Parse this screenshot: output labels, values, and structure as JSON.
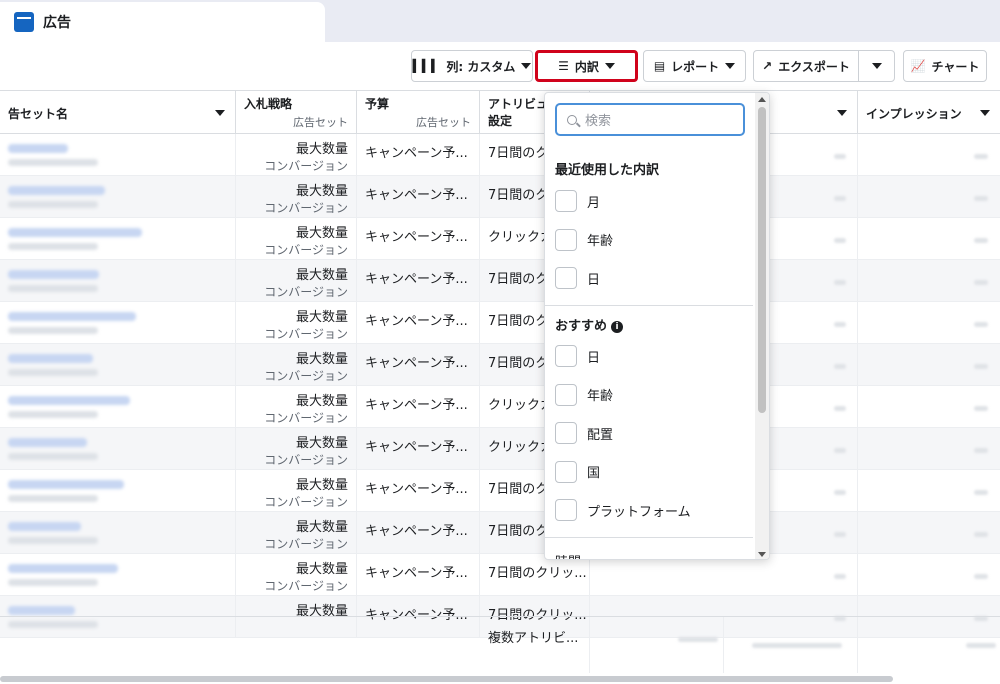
{
  "tab": {
    "label": "広告"
  },
  "toolbar": {
    "columns_label": "列: カスタム",
    "breakdown_label": "内訳",
    "report_label": "レポート",
    "export_label": "エクスポート",
    "chart_label": "チャート"
  },
  "table": {
    "headers": {
      "adset_name": "告セット名",
      "bid_strategy": "入札戦略",
      "bid_strategy_sub": "広告セット",
      "budget": "予算",
      "budget_sub": "広告セット",
      "attribution_line1": "アトリビュー",
      "attribution_line2": "設定",
      "impressions": "インプレッション"
    },
    "rows": [
      {
        "bid": "最大数量",
        "bid_sub": "コンバージョン",
        "budget": "キャンペーン予...",
        "attribution": "7日間のク"
      },
      {
        "bid": "最大数量",
        "bid_sub": "コンバージョン",
        "budget": "キャンペーン予...",
        "attribution": "7日間のク"
      },
      {
        "bid": "最大数量",
        "bid_sub": "コンバージョン",
        "budget": "キャンペーン予...",
        "attribution": "クリックカ"
      },
      {
        "bid": "最大数量",
        "bid_sub": "コンバージョン",
        "budget": "キャンペーン予...",
        "attribution": "7日間のク"
      },
      {
        "bid": "最大数量",
        "bid_sub": "コンバージョン",
        "budget": "キャンペーン予...",
        "attribution": "7日間のク"
      },
      {
        "bid": "最大数量",
        "bid_sub": "コンバージョン",
        "budget": "キャンペーン予...",
        "attribution": "7日間のク"
      },
      {
        "bid": "最大数量",
        "bid_sub": "コンバージョン",
        "budget": "キャンペーン予...",
        "attribution": "クリックカ"
      },
      {
        "bid": "最大数量",
        "bid_sub": "コンバージョン",
        "budget": "キャンペーン予...",
        "attribution": "クリックカ"
      },
      {
        "bid": "最大数量",
        "bid_sub": "コンバージョン",
        "budget": "キャンペーン予...",
        "attribution": "7日間のク"
      },
      {
        "bid": "最大数量",
        "bid_sub": "コンバージョン",
        "budget": "キャンペーン予...",
        "attribution": "7日間のク"
      },
      {
        "bid": "最大数量",
        "bid_sub": "コンバージョン",
        "budget": "キャンペーン予...",
        "attribution": "7日間のクリッ..."
      },
      {
        "bid": "最大数量",
        "bid_sub": "",
        "budget": "キャンペーン予...",
        "attribution": "7日間のクリッ..."
      }
    ],
    "footer_attribution": "複数アトリビ..."
  },
  "breakdown_menu": {
    "search_placeholder": "検索",
    "recent_title": "最近使用した内訳",
    "recent": [
      "月",
      "年齢",
      "日"
    ],
    "recommended_title": "おすすめ",
    "recommended": [
      "日",
      "年齢",
      "配置",
      "国",
      "プラットフォーム"
    ],
    "next_section_partial": "時間"
  },
  "colors": {
    "highlight_border": "#d0021b",
    "search_focus": "#4a90d9",
    "tab_icon": "#1565c0"
  }
}
